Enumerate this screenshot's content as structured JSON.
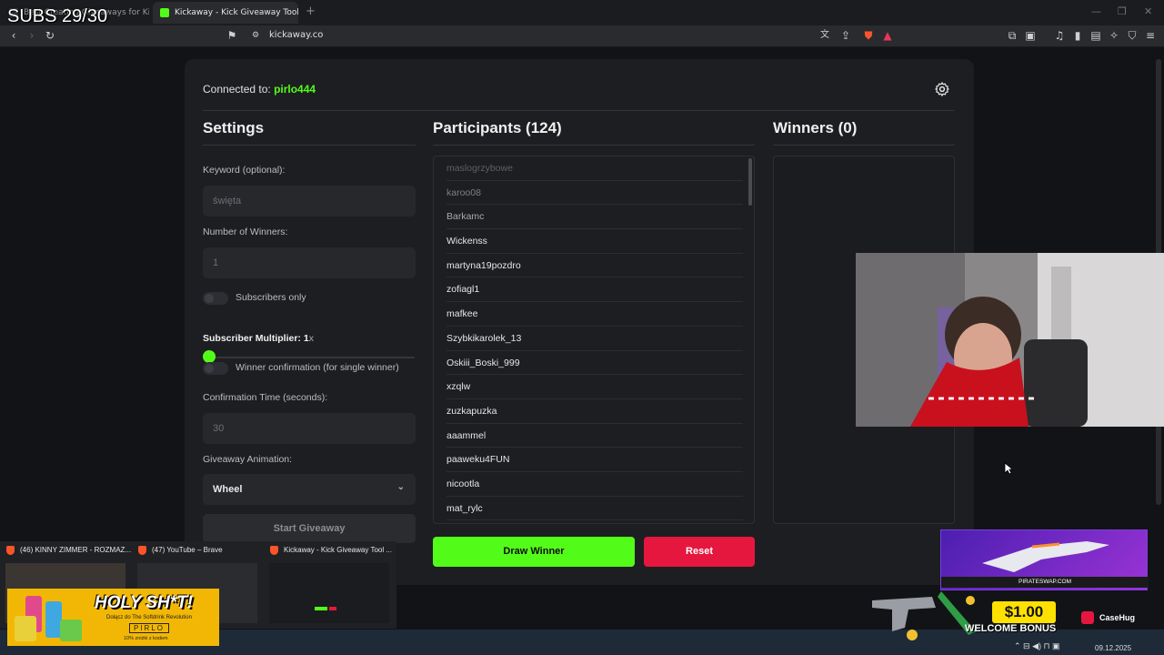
{
  "overlay": {
    "subs_counter": "SUBS 29/30"
  },
  "browser": {
    "tabs": [
      {
        "label": "Best Creating Giveaways for Ki",
        "active": false
      },
      {
        "label": "Kickaway - Kick Giveaway Tool",
        "active": true
      }
    ],
    "url": "kickaway.co"
  },
  "app": {
    "connected_prefix": "Connected to:",
    "connected_user": "pirlo444",
    "accent": "#53fc18",
    "settings": {
      "title": "Settings",
      "keyword_label": "Keyword (optional):",
      "keyword_placeholder": "święta",
      "winners_label": "Number of Winners:",
      "winners_placeholder": "1",
      "subscribers_only_label": "Subscribers only",
      "multiplier_label": "Subscriber Multiplier: 1",
      "multiplier_suffix": "x",
      "multiplier_value": 1,
      "winner_confirmation_label": "Winner confirmation (for single winner)",
      "confirmation_time_label": "Confirmation Time (seconds):",
      "confirmation_time_placeholder": "30",
      "animation_label": "Giveaway Animation:",
      "animation_value": "Wheel",
      "start_button": "Start Giveaway"
    },
    "participants": {
      "title": "Participants (124)",
      "items": [
        "maslogrzybowe",
        "karoo08",
        "Barkamc",
        "Wickenss",
        "martyna19pozdro",
        "zofiagl1",
        "mafkee",
        "Szybkikarolek_13",
        "Oskiii_Boski_999",
        "xzqlw",
        "zuzkapuzka",
        "aaammel",
        "paaweku4FUN",
        "nicootla",
        "mat_rylc"
      ]
    },
    "winners": {
      "title": "Winners (0)"
    },
    "draw_button": "Draw Winner",
    "reset_button": "Reset",
    "danger_color": "#e5173f"
  },
  "taskbar": {
    "previews": [
      {
        "label": "(46) KINNY ZIMMER - ROZMAZ..."
      },
      {
        "label": "(47) YouTube – Brave"
      },
      {
        "label": "Kickaway - Kick Giveaway Tool ..."
      }
    ],
    "date": "09.12.2025"
  },
  "ads": {
    "holy_title": "HOLY SH*T!",
    "holy_line1": "Dołącz do The Softdrink Revolution",
    "holy_brand": "PIRLO",
    "holy_line2": "10% zniżki z kodem",
    "pirate_brand": "PIRATESWAP.COM",
    "bonus_amount": "$1.00",
    "bonus_text": "WELCOME BONUS",
    "casehug": "CaseHug"
  }
}
